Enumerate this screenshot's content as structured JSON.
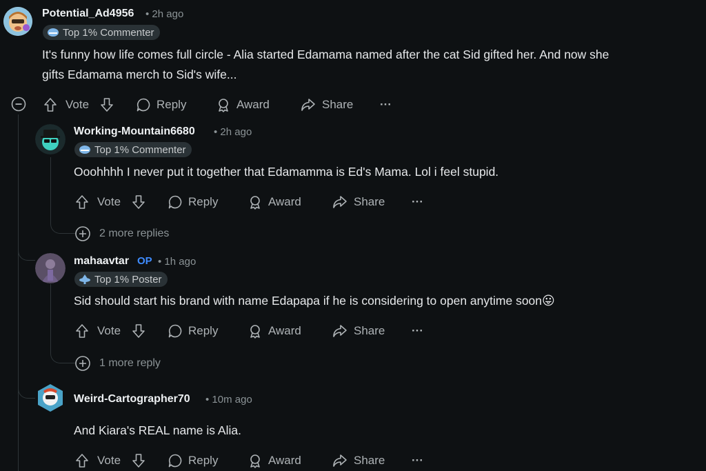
{
  "comments": [
    {
      "username": "Potential_Ad4956",
      "time": "• 2h ago",
      "flair": "Top 1% Commenter",
      "body_line1": "It's funny how life comes full circle - Alia started Edamama named after the cat Sid gifted her. And now she",
      "body_line2": "gifts Edamama merch to Sid's wife...",
      "actions": {
        "vote": "Vote",
        "reply": "Reply",
        "award": "Award",
        "share": "Share",
        "more": "···"
      }
    },
    {
      "username": "Working-Mountain6680",
      "time": "• 2h ago",
      "flair": "Top 1% Commenter",
      "body": "Ooohhhh I never put it together that Edamamma is Ed's Mama. Lol i feel stupid.",
      "actions": {
        "vote": "Vote",
        "reply": "Reply",
        "award": "Award",
        "share": "Share",
        "more": "···"
      },
      "more_replies": "2 more replies"
    },
    {
      "username": "mahaavtar",
      "op_badge": "OP",
      "time": "• 1h ago",
      "flair": "Top 1% Poster",
      "body": "Sid should start his brand with name Edapapa if he is considering to open anytime soon",
      "emoji": "😛",
      "actions": {
        "vote": "Vote",
        "reply": "Reply",
        "award": "Award",
        "share": "Share",
        "more": "···"
      },
      "more_replies": "1 more reply"
    },
    {
      "username": "Weird-Cartographer70",
      "time": "• 10m ago",
      "body": "And Kiara's REAL name is Alia.",
      "actions": {
        "vote": "Vote",
        "reply": "Reply",
        "award": "Award",
        "share": "Share",
        "more": "···"
      }
    }
  ],
  "colors": {
    "background": "#0e1113",
    "op": "#3f8cff",
    "flair_bg": "#2a3236",
    "thread_line": "#2e3538"
  }
}
